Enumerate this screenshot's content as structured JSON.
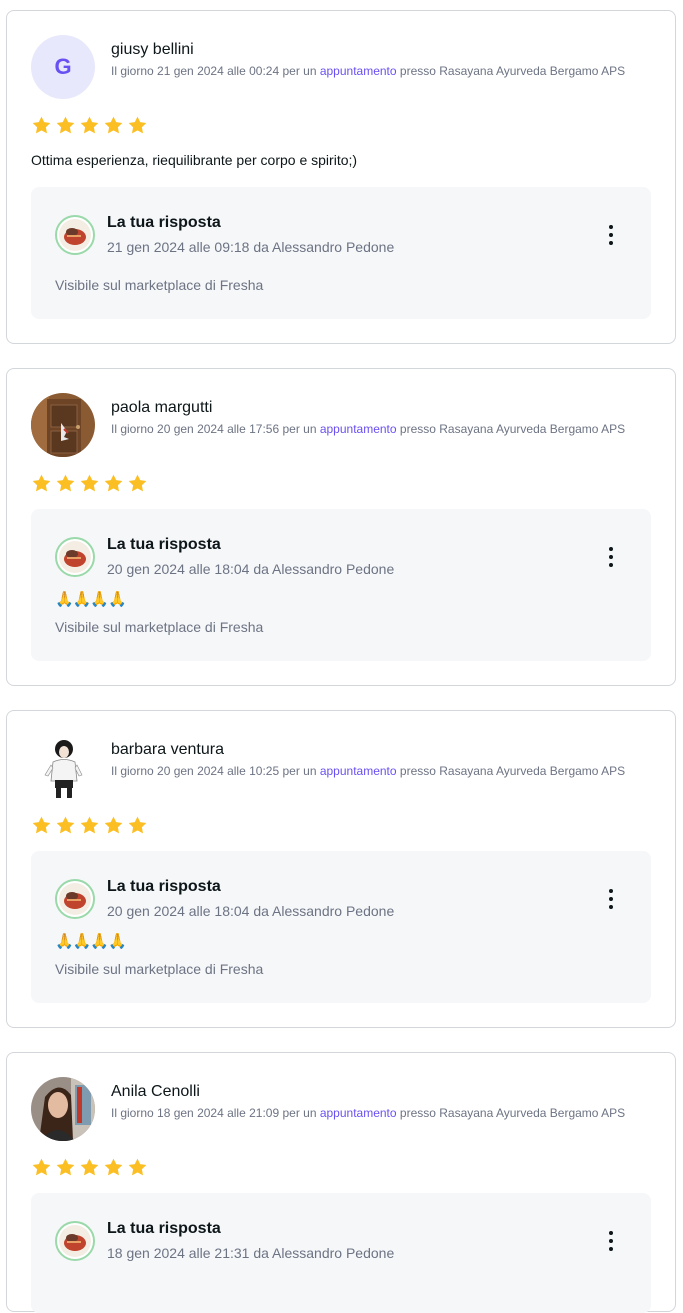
{
  "reviews": [
    {
      "name": "giusy bellini",
      "avatar_initial": "G",
      "avatar_type": "initial",
      "meta_prefix": "Il giorno 21 gen 2024 alle 00:24 per un ",
      "meta_link": "appuntamento",
      "meta_suffix": " presso Rasayana Ayurveda Bergamo APS",
      "rating": 5,
      "text": "Ottima esperienza, riequilibrante per corpo e spirito;)",
      "reply": {
        "title": "La tua risposta",
        "date": "21 gen 2024 alle 09:18 da Alessandro Pedone",
        "emoji": "",
        "visible": "Visibile sul marketplace di Fresha"
      }
    },
    {
      "name": "paola margutti",
      "avatar_type": "photo-door",
      "meta_prefix": "Il giorno 20 gen 2024 alle 17:56 per un ",
      "meta_link": "appuntamento",
      "meta_suffix": " presso Rasayana Ayurveda Bergamo APS",
      "rating": 5,
      "text": "",
      "reply": {
        "title": "La tua risposta",
        "date": "20 gen 2024 alle 18:04 da Alessandro Pedone",
        "emoji": "🙏🙏🙏🙏",
        "visible": "Visibile sul marketplace di Fresha"
      }
    },
    {
      "name": "barbara ventura",
      "avatar_type": "photo-figure",
      "meta_prefix": "Il giorno 20 gen 2024 alle 10:25 per un ",
      "meta_link": "appuntamento",
      "meta_suffix": " presso Rasayana Ayurveda Bergamo APS",
      "rating": 5,
      "text": "",
      "reply": {
        "title": "La tua risposta",
        "date": "20 gen 2024 alle 18:04 da Alessandro Pedone",
        "emoji": "🙏🙏🙏🙏",
        "visible": "Visibile sul marketplace di Fresha"
      }
    },
    {
      "name": "Anila Cenolli",
      "avatar_type": "photo-portrait",
      "meta_prefix": "Il giorno 18 gen 2024 alle 21:09 per un ",
      "meta_link": "appuntamento",
      "meta_suffix": " presso Rasayana Ayurveda Bergamo APS",
      "rating": 5,
      "text": "",
      "reply": {
        "title": "La tua risposta",
        "date": "18 gen 2024 alle 21:31 da Alessandro Pedone",
        "emoji": "",
        "visible": ""
      }
    }
  ],
  "colors": {
    "star": "#fbbf24",
    "link": "#6950f3",
    "reply_bg": "#f6f7f9",
    "muted_text": "#6c7383"
  },
  "icons": {
    "star": "star-icon",
    "more": "more-vertical-icon",
    "reply_avatar": "business-logo-icon"
  }
}
